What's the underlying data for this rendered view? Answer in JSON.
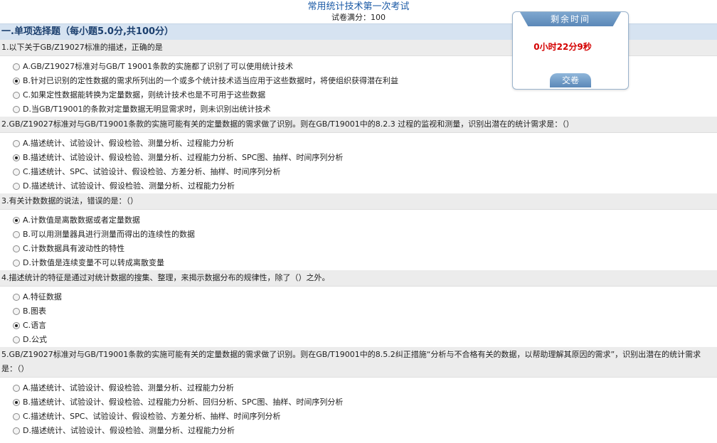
{
  "header": {
    "title": "常用统计技术第一次考试",
    "score_label": "试卷满分：100"
  },
  "section": {
    "title": "一.单项选择题（每小题5.0分,共100分）"
  },
  "timer": {
    "header": "剩余时间",
    "remaining": "0小时22分9秒",
    "submit_label": "交卷"
  },
  "questions": [
    {
      "text": "1.以下关于GB/Z19027标准的描述，正确的是",
      "options": [
        "A.GB/Z19027标准对与GB/T 19001条款的实施都了识别了可以使用统计技术",
        "B.针对已识别的定性数据的需求所列出的一个或多个统计技术适当应用于这些数据时，将使组织获得潜在利益",
        "C.如果定性数据能转换为定量数据，则统计技术也是不可用于这些数据",
        "D.当GB/T19001的条款对定量数据无明显需求时，则未识别出统计技术"
      ],
      "selected": "B"
    },
    {
      "text": "2.GB/Z19027标准对与GB/T19001条款的实施可能有关的定量数据的需求做了识别。则在GB/T19001中的8.2.3 过程的监视和测量，识别出潜在的统计需求是：（）",
      "options": [
        "A.描述统计、试验设计、假设检验、测量分析、过程能力分析",
        "B.描述统计、试验设计、假设检验、测量分析、过程能力分析、SPC图、抽样、时间序列分析",
        "C.描述统计、SPC、试验设计、假设检验、方差分析、抽样、时间序列分析",
        "D.描述统计、试验设计、假设检验、测量分析、过程能力分析"
      ],
      "selected": "B"
    },
    {
      "text": "3.有关计数数据的说法，错误的是：（）",
      "options": [
        "A.计数值是离散数据或者定量数据",
        "B.可以用测量器具进行测量而得出的连续性的数据",
        "C.计数数据具有波动性的特性",
        "D.计数值是连续变量不可以转成离散变量"
      ],
      "selected": "A"
    },
    {
      "text": "4.描述统计的特征是通过对统计数据的搜集、整理，来揭示数据分布的规律性，除了（）之外。",
      "options": [
        "A.特征数据",
        "B.图表",
        "C.语言",
        "D.公式"
      ],
      "selected": "C"
    },
    {
      "text": "5.GB/Z19027标准对与GB/T19001条款的实施可能有关的定量数据的需求做了识别。则在GB/T19001中的8.5.2纠正措施“分析与不合格有关的数据，以帮助理解其原因的需求”，识别出潜在的统计需求是：（）",
      "options": [
        "A.描述统计、试验设计、假设检验、测量分析、过程能力分析",
        "B.描述统计、试验设计、假设检验、过程能力分析、回归分析、SPC图、抽样、时间序列分析",
        "C.描述统计、SPC、试验设计、假设检验、方差分析、抽样、时间序列分析",
        "D.描述统计、试验设计、假设检验、测量分析、过程能力分析"
      ],
      "selected": "B"
    }
  ]
}
